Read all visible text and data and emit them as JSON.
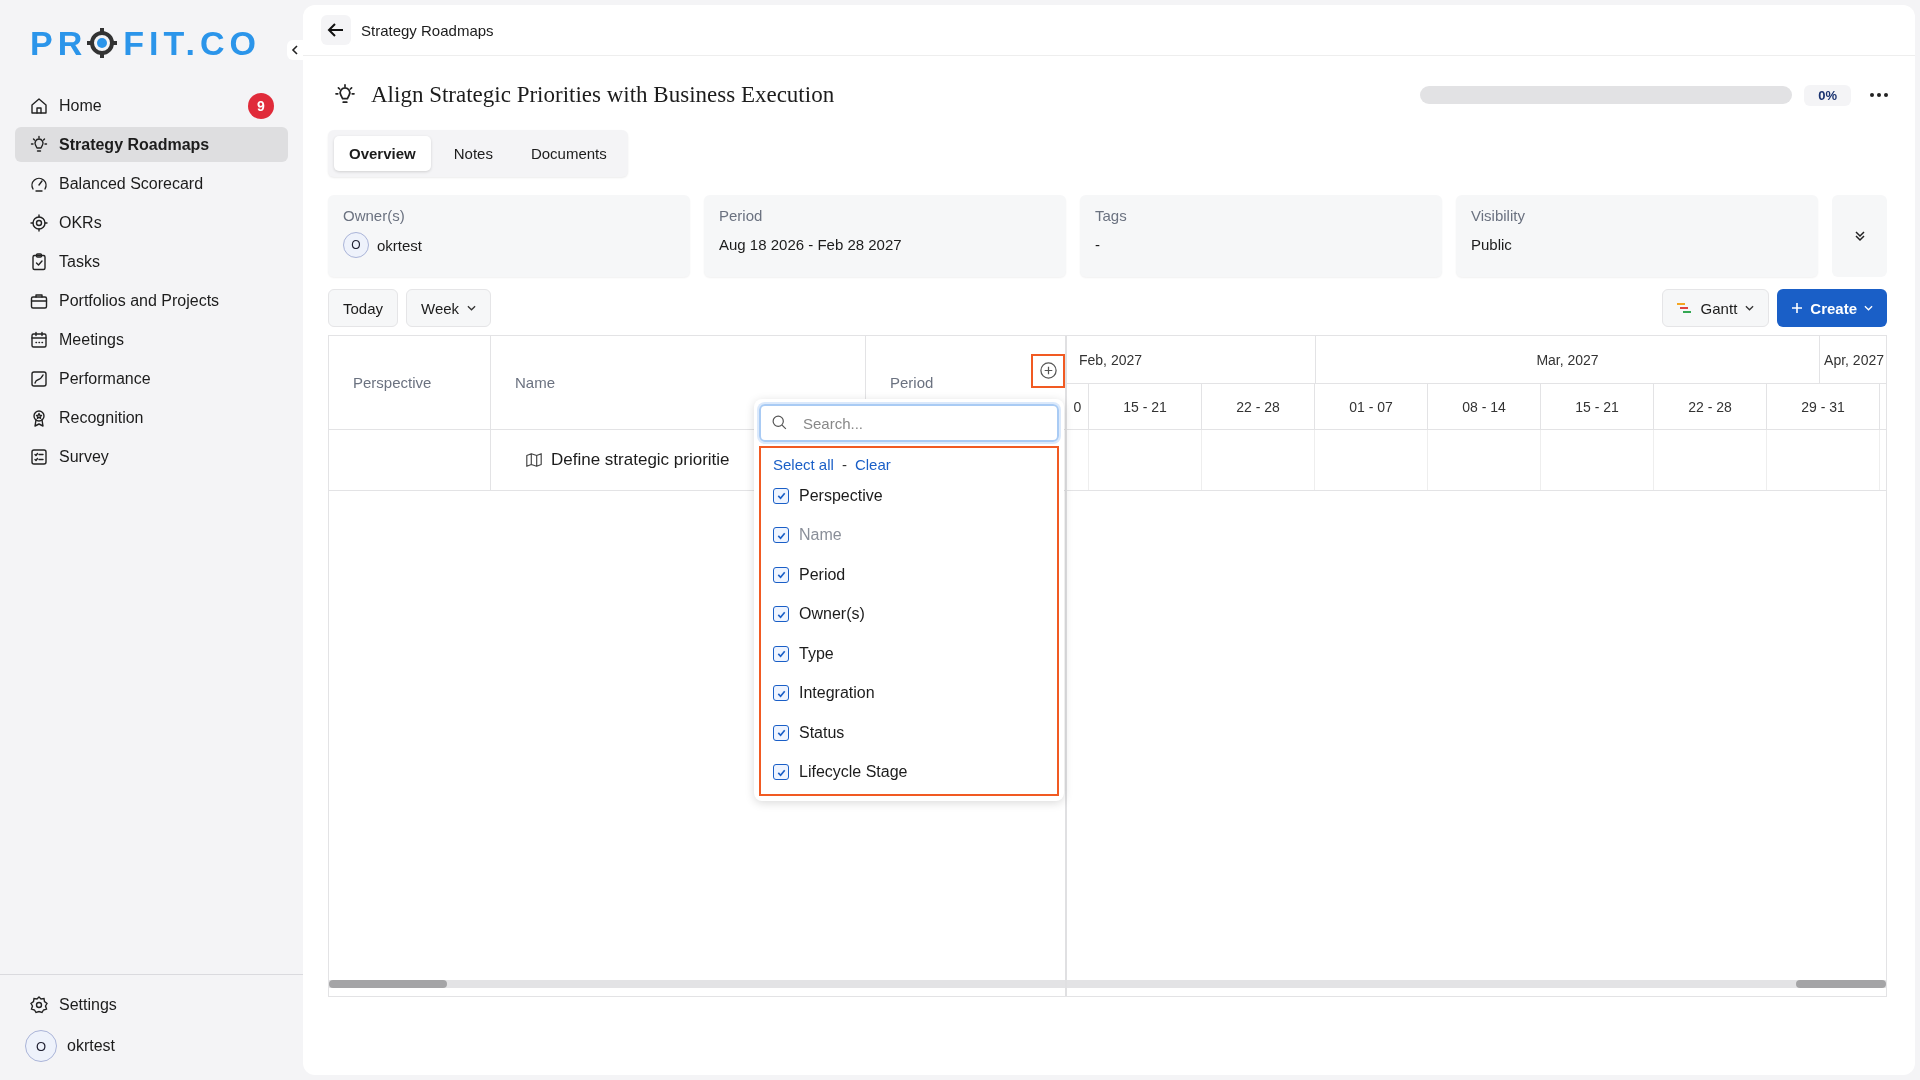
{
  "sidebar": {
    "logo": {
      "before": "PR",
      "after": "FIT.CO"
    },
    "items": [
      {
        "label": "Home",
        "badge": "9",
        "selected": false
      },
      {
        "label": "Strategy Roadmaps",
        "selected": true
      },
      {
        "label": "Balanced Scorecard",
        "selected": false
      },
      {
        "label": "OKRs",
        "selected": false
      },
      {
        "label": "Tasks",
        "selected": false
      },
      {
        "label": "Portfolios and Projects",
        "selected": false
      },
      {
        "label": "Meetings",
        "selected": false
      },
      {
        "label": "Performance",
        "selected": false
      },
      {
        "label": "Recognition",
        "selected": false
      },
      {
        "label": "Survey",
        "selected": false
      }
    ],
    "settings": "Settings",
    "user": {
      "initial": "O",
      "name": "okrtest"
    }
  },
  "breadcrumb": "Strategy Roadmaps",
  "title": "Align Strategic Priorities with Business Execution",
  "progress": {
    "level": 0,
    "reading": "0%"
  },
  "tabs": [
    {
      "label": "Overview",
      "selected": true
    },
    {
      "label": "Notes",
      "selected": false
    },
    {
      "label": "Documents",
      "selected": false
    }
  ],
  "info_cards": [
    {
      "kind": "owner",
      "label": "Owner(s)",
      "initial": "O",
      "value": "okrtest"
    },
    {
      "kind": "text",
      "label": "Period",
      "value": "Aug 18 2026 - Feb 28 2027"
    },
    {
      "kind": "text",
      "label": "Tags",
      "value": "-"
    },
    {
      "kind": "text",
      "label": "Visibility",
      "value": "Public"
    }
  ],
  "toolbar": {
    "today": "Today",
    "scale": "Week",
    "view": "Gantt",
    "create": "Create"
  },
  "table": {
    "columns": [
      "Perspective",
      "Name",
      "Period"
    ],
    "rows": [
      {
        "perspective": "",
        "name": "Define strategic prioritie"
      }
    ]
  },
  "timeline": {
    "months": [
      "Feb, 2027",
      "Mar, 2027",
      "Apr, 2027"
    ],
    "weeks": [
      "0",
      "15 - 21",
      "22 - 28",
      "01 - 07",
      "08 - 14",
      "15 - 21",
      "22 - 28",
      "29 - 31"
    ]
  },
  "column_menu": {
    "placeholder": "Search...",
    "select_all": "Select all",
    "separator": "-",
    "clear": "Clear",
    "options": [
      {
        "label": "Perspective",
        "checked": true,
        "disabled": false
      },
      {
        "label": "Name",
        "checked": true,
        "disabled": true
      },
      {
        "label": "Period",
        "checked": true,
        "disabled": false
      },
      {
        "label": "Owner(s)",
        "checked": true,
        "disabled": false
      },
      {
        "label": "Type",
        "checked": true,
        "disabled": false
      },
      {
        "label": "Integration",
        "checked": true,
        "disabled": false
      },
      {
        "label": "Status",
        "checked": true,
        "disabled": false
      },
      {
        "label": "Lifecycle Stage",
        "checked": true,
        "disabled": false
      }
    ]
  }
}
